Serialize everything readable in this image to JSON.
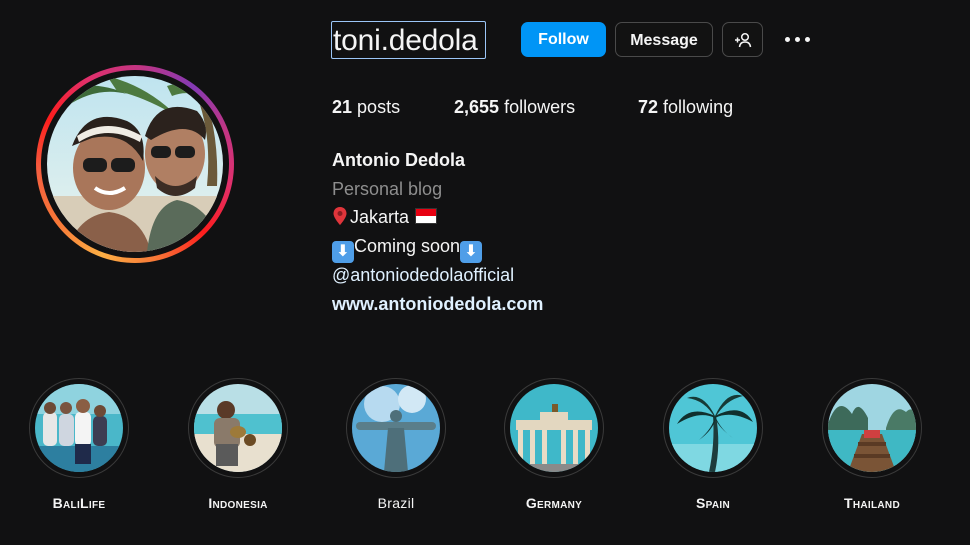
{
  "profile": {
    "username": "toni.dedola",
    "follow_label": "Follow",
    "message_label": "Message",
    "posts_count": "21",
    "posts_label": "posts",
    "followers_count": "2,655",
    "followers_label": "followers",
    "following_count": "72",
    "following_label": "following",
    "full_name": "Antonio Dedola",
    "category": "Personal blog",
    "location": "Jakarta",
    "tagline": "Coming soon",
    "handle": "@antoniodedolaofficial",
    "website": "www.antoniodedola.com"
  },
  "highlights": [
    {
      "label": "BaliLife"
    },
    {
      "label": "Indonesia"
    },
    {
      "label": "Brazil"
    },
    {
      "label": "Germany"
    },
    {
      "label": "Spain"
    },
    {
      "label": "Thailand"
    }
  ],
  "colors": {
    "background": "#111112",
    "accent": "#0095f6",
    "secondary_text": "#8e8e8e",
    "link": "#e0f1ff"
  },
  "icons": [
    "add-person-icon",
    "more-options-icon",
    "location-pin-icon",
    "down-arrow-icon",
    "indonesia-flag-icon"
  ]
}
